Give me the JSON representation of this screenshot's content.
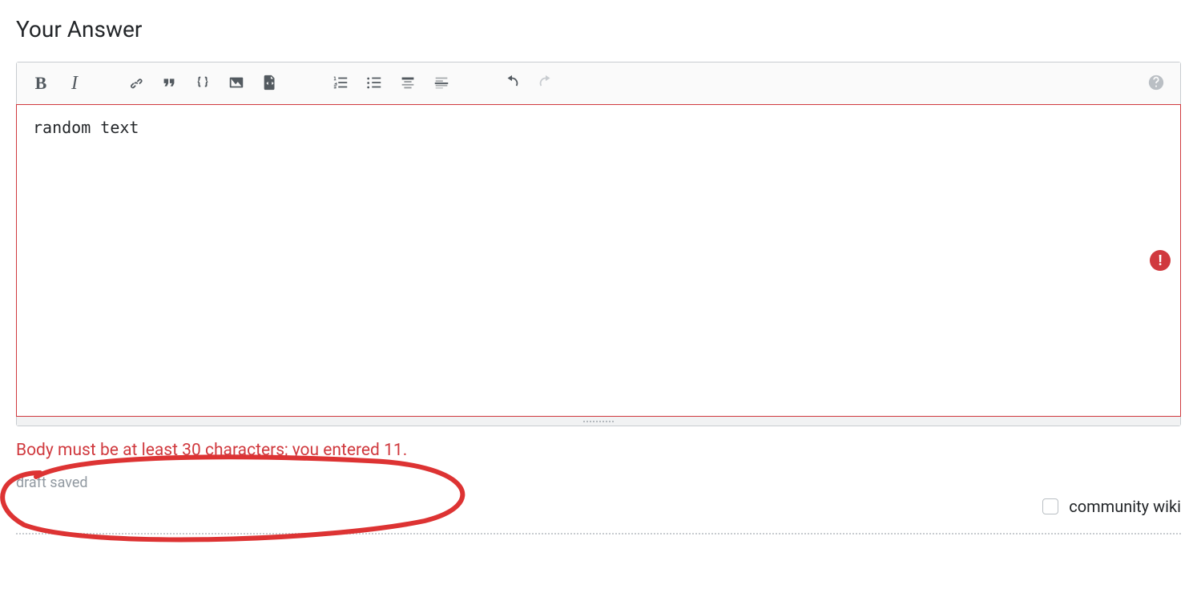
{
  "heading": "Your Answer",
  "toolbar": {
    "bold": "B",
    "italic": "I"
  },
  "editor": {
    "value": "random text"
  },
  "validation": {
    "message": "Body must be at least 30 characters; you entered 11.",
    "badge_glyph": "!"
  },
  "draft_status": "draft saved",
  "community_wiki": {
    "label": "community wiki",
    "checked": false
  }
}
